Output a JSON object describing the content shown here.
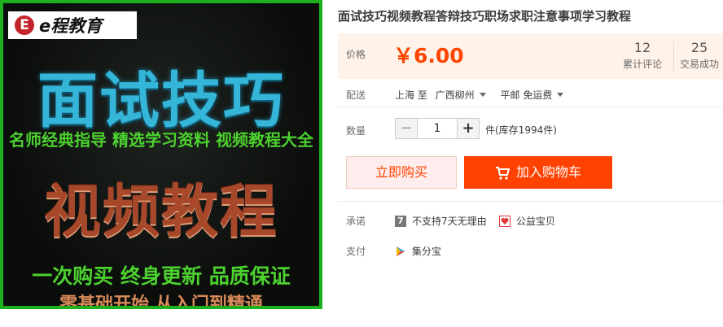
{
  "product_image": {
    "logo_mark": "E",
    "logo_text": "e程教育",
    "headline": "面试技巧",
    "tagline": "名师经典指导 精选学习资料 视频教程大全",
    "headline2": "视频教程",
    "slogan": "一次购买  终身更新  品质保证",
    "slogan2": "零基础开始  从入门到精通"
  },
  "product": {
    "title": "面试技巧视频教程答辩技巧职场求职注意事项学习教程"
  },
  "price": {
    "label": "价格",
    "value": "￥6.00",
    "reviews_count": "12",
    "reviews_label": "累计评论",
    "sales_count": "25",
    "sales_label": "交易成功"
  },
  "shipping": {
    "label": "配送",
    "from": "上海 至",
    "to": "广西柳州",
    "method": "平邮 免运费"
  },
  "quantity": {
    "label": "数量",
    "minus": "−",
    "value": "1",
    "plus": "+",
    "stock": "件(库存1994件)"
  },
  "actions": {
    "buy_now": "立即购买",
    "add_to_cart": "加入购物车"
  },
  "promises": {
    "label": "承诺",
    "no_return_icon_text": "7",
    "no_return": "不支持7天无理由",
    "charity": "公益宝贝"
  },
  "payment": {
    "label": "支付",
    "method": "集分宝"
  },
  "colors": {
    "accent": "#ff4400",
    "cart_button": "#ff4200",
    "price_bg": "#fff2e8",
    "image_border": "#1db01d"
  }
}
